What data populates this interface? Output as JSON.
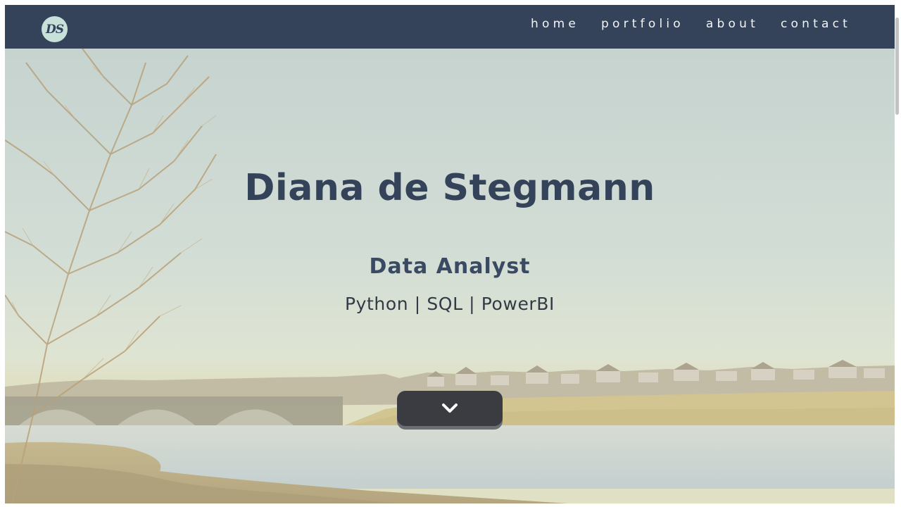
{
  "logo": {
    "text": "DS"
  },
  "nav": {
    "items": [
      {
        "label": "home"
      },
      {
        "label": "portfolio"
      },
      {
        "label": "about"
      },
      {
        "label": "contact"
      }
    ]
  },
  "hero": {
    "title": "Diana de Stegmann",
    "role": "Data Analyst",
    "skills": "Python | SQL | PowerBI",
    "scroll_icon": "chevron-down-icon"
  },
  "colors": {
    "navbar": "#34435a",
    "title": "#34435a",
    "logo_bg": "#c7e0d9",
    "button": "#3b3b42"
  }
}
